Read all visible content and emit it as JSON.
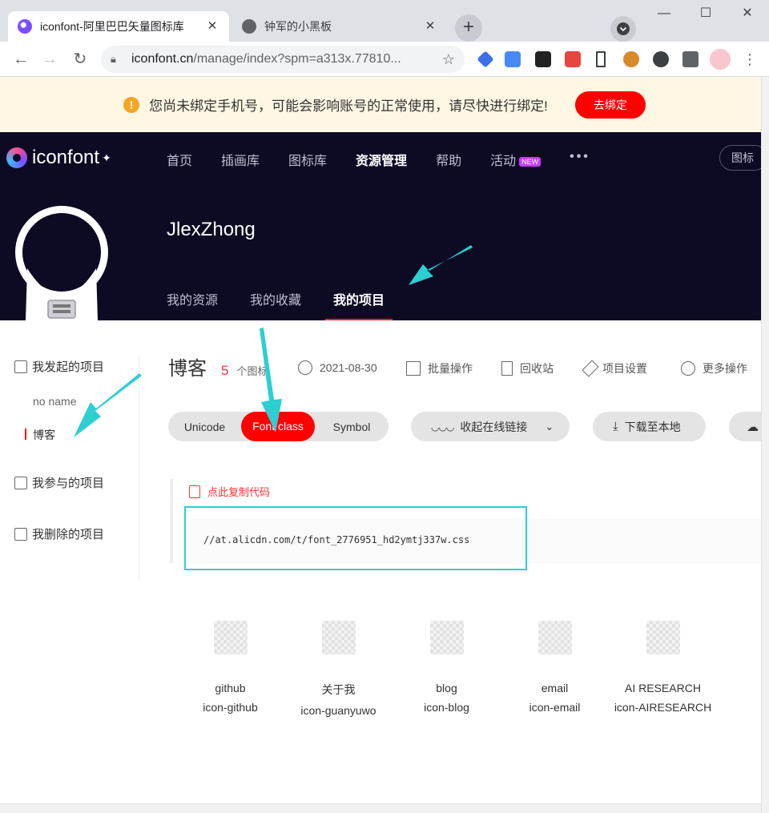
{
  "browser": {
    "tabs": [
      {
        "title": "iconfont-阿里巴巴矢量图标库",
        "active": true
      },
      {
        "title": "钟军的小黑板",
        "active": false
      }
    ],
    "url_main": "iconfont.cn",
    "url_path": "/manage/index?spm=a313x.77810..."
  },
  "notice": {
    "text": "您尚未绑定手机号，可能会影响账号的正常使用，请尽快进行绑定!",
    "button": "去绑定"
  },
  "header": {
    "logo": "iconfont",
    "nav": [
      {
        "label": "首页"
      },
      {
        "label": "插画库"
      },
      {
        "label": "图标库"
      },
      {
        "label": "资源管理",
        "active": true
      },
      {
        "label": "帮助"
      },
      {
        "label": "活动",
        "badge": "NEW"
      }
    ],
    "toggle": "图标",
    "username": "JlexZhong",
    "subnav": [
      {
        "label": "我的资源"
      },
      {
        "label": "我的收藏"
      },
      {
        "label": "我的项目",
        "active": true
      }
    ]
  },
  "sidebar": {
    "groups": [
      {
        "label": "我发起的项目"
      },
      {
        "label": "我参与的项目"
      },
      {
        "label": "我删除的项目"
      }
    ],
    "projects": [
      {
        "label": "no name"
      },
      {
        "label": "博客",
        "active": true
      }
    ]
  },
  "project": {
    "name": "博客",
    "count": "5",
    "count_unit": "个图标",
    "date": "2021-08-30",
    "actions": [
      "批量操作",
      "回收站",
      "项目设置",
      "更多操作"
    ]
  },
  "modes": [
    "Unicode",
    "Font class",
    "Symbol"
  ],
  "toolbar": {
    "collapse": "收起在线链接",
    "download": "下载至本地"
  },
  "code": {
    "copy_label": "点此复制代码",
    "link": "//at.alicdn.com/t/font_2776951_hd2ymtj337w.css"
  },
  "icons": [
    {
      "name": "github",
      "class": "icon-github"
    },
    {
      "name": "关于我",
      "class": "icon-guanyuwo"
    },
    {
      "name": "blog",
      "class": "icon-blog"
    },
    {
      "name": "email",
      "class": "icon-email"
    },
    {
      "name": "AI RESEARCH",
      "class": "icon-AIRESEARCH"
    }
  ],
  "colors": {
    "accent": "#ff0000",
    "header_bg": "#0d0a24",
    "annotation": "#2ccfd2"
  }
}
